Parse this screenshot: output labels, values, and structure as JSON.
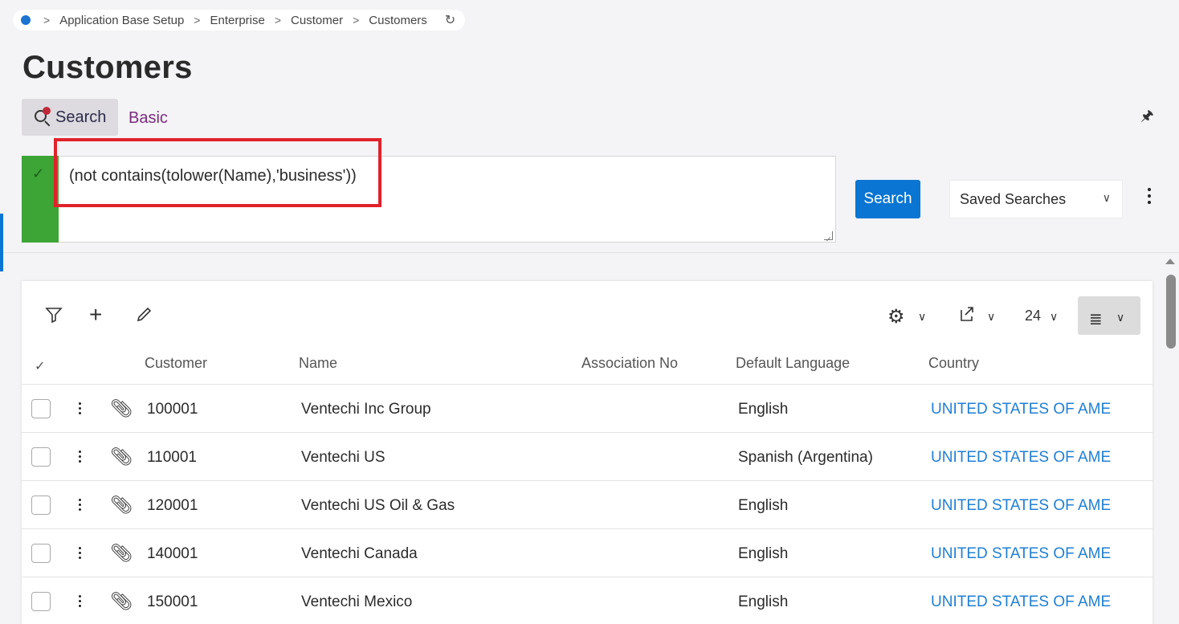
{
  "breadcrumb": {
    "items": [
      "Application Base Setup",
      "Enterprise",
      "Customer",
      "Customers"
    ]
  },
  "page": {
    "title": "Customers"
  },
  "search": {
    "mode_label": "Search",
    "basic_label": "Basic",
    "query": "(not contains(tolower(Name),'business'))",
    "button_label": "Search",
    "saved_searches_label": "Saved Searches"
  },
  "grid": {
    "page_size": "24",
    "columns": [
      "Customer",
      "Name",
      "Association No",
      "Default Language",
      "Country"
    ],
    "rows": [
      {
        "customer": "100001",
        "name": "Ventechi Inc Group",
        "association_no": "",
        "language": "English",
        "country": "UNITED STATES OF AME"
      },
      {
        "customer": "110001",
        "name": "Ventechi US",
        "association_no": "",
        "language": "Spanish (Argentina)",
        "country": "UNITED STATES OF AME"
      },
      {
        "customer": "120001",
        "name": "Ventechi US Oil & Gas",
        "association_no": "",
        "language": "English",
        "country": "UNITED STATES OF AME"
      },
      {
        "customer": "140001",
        "name": "Ventechi Canada",
        "association_no": "",
        "language": "English",
        "country": "UNITED STATES OF AME"
      },
      {
        "customer": "150001",
        "name": "Ventechi Mexico",
        "association_no": "",
        "language": "English",
        "country": "UNITED STATES OF AME"
      }
    ]
  },
  "colors": {
    "accent": "#0a75d2",
    "valid_green": "#3ca535",
    "highlight_red": "#e0222a",
    "link_purple": "#7b2d7e",
    "country_link": "#1f7fd4"
  },
  "icons": [
    "home-dot-icon",
    "refresh-icon",
    "search-icon",
    "pin-icon",
    "check-icon",
    "kebab-icon",
    "filter-icon",
    "add-icon",
    "edit-icon",
    "settings-icon",
    "export-icon",
    "list-view-icon",
    "chevron-down-icon",
    "paperclip-icon"
  ]
}
